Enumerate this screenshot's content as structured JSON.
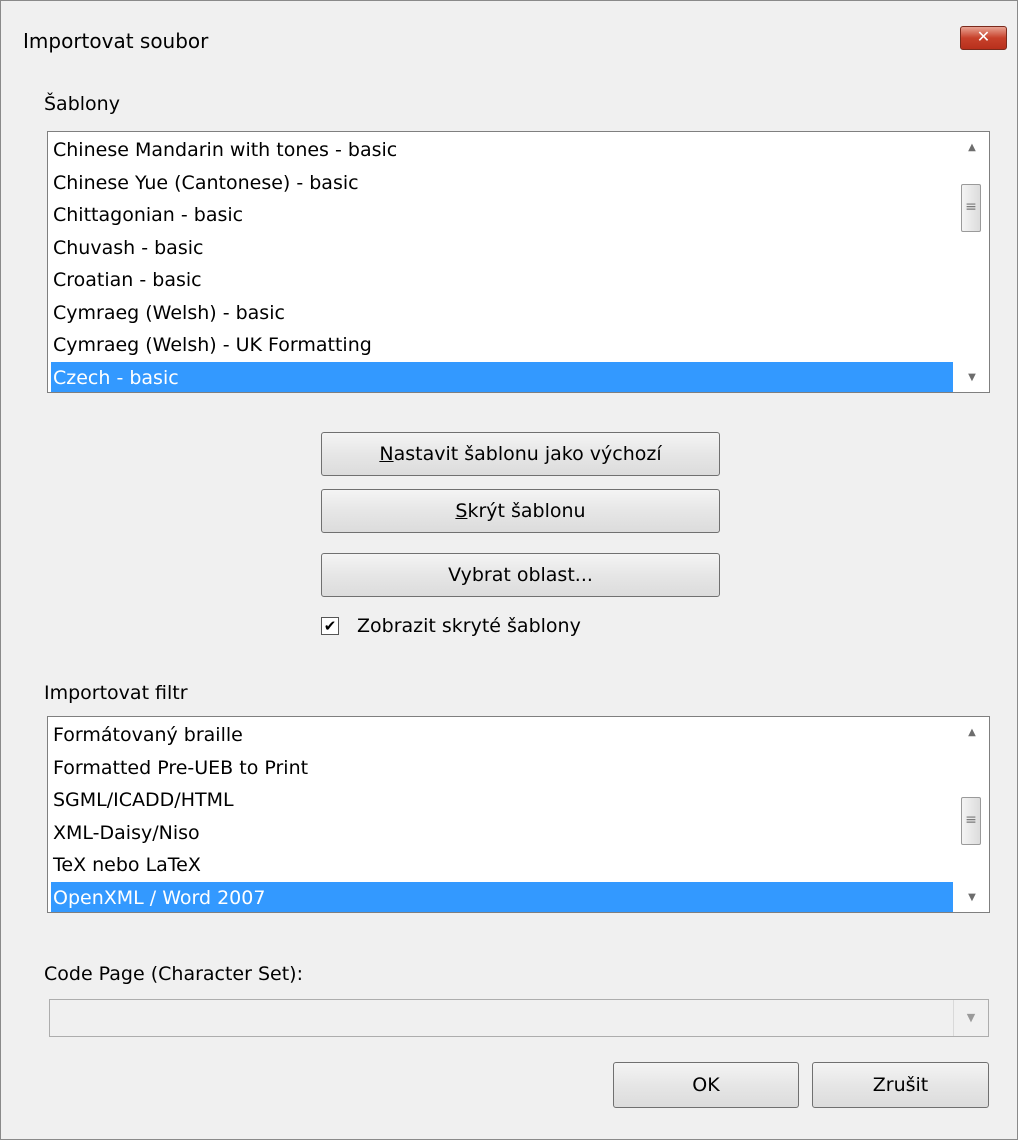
{
  "window": {
    "title": "Importovat soubor",
    "close_label": "✕"
  },
  "templates": {
    "label": "Šablony",
    "items": [
      "Chinese Mandarin with tones - basic",
      "Chinese Yue (Cantonese) - basic",
      "Chittagonian - basic",
      "Chuvash - basic",
      "Croatian - basic",
      "Cymraeg (Welsh) - basic",
      "Cymraeg (Welsh) - UK Formatting",
      "Czech - basic"
    ],
    "selected_index": 7
  },
  "buttons": {
    "set_default": {
      "accel": "N",
      "rest": "astavit šablonu jako výchozí"
    },
    "hide": {
      "pre": "",
      "accel": "S",
      "rest": "krýt šablonu"
    },
    "select_area": "Vybrat oblast..."
  },
  "show_hidden": {
    "label": "Zobrazit skryté šablony",
    "checked": true,
    "mark": "✔"
  },
  "filters": {
    "label": "Importovat filtr",
    "items": [
      "Formátovaný braille",
      "Formatted Pre-UEB to Print",
      "SGML/ICADD/HTML",
      "XML-Daisy/Niso",
      "TeX nebo LaTeX",
      "OpenXML / Word 2007"
    ],
    "selected_index": 5
  },
  "codepage": {
    "label": "Code Page (Character Set):",
    "value": ""
  },
  "footer": {
    "ok": "OK",
    "cancel": "Zrušit"
  },
  "icons": {
    "up": "▲",
    "down": "▼",
    "grip": "≡",
    "combo_down": "▼"
  }
}
